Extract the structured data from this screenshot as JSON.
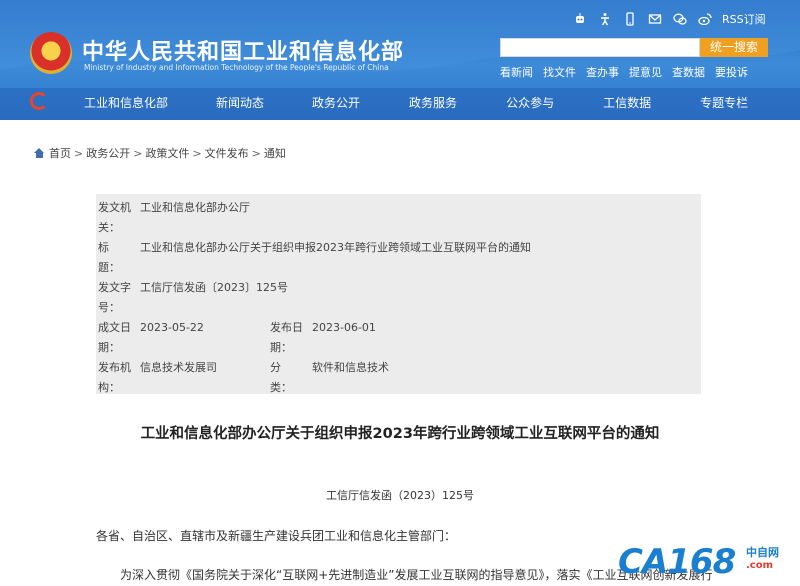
{
  "header": {
    "title": "中华人民共和国工业和信息化部",
    "subtitle_en": "Ministry of Industry and Information Technology of the People's Republic of China",
    "icons": [
      "robot-icon",
      "accessibility-icon",
      "mobile-icon",
      "mail-icon",
      "wechat-icon",
      "weibo-icon"
    ],
    "rss_label": "RSS订阅",
    "search_placeholder": "",
    "search_button": "统一搜索",
    "quick_links": [
      "看新闻",
      "找文件",
      "查办事",
      "提意见",
      "查数据",
      "要投诉"
    ]
  },
  "nav": {
    "items": [
      "工业和信息化部",
      "新闻动态",
      "政务公开",
      "政务服务",
      "公众参与",
      "工信数据",
      "专题专栏"
    ]
  },
  "breadcrumb": [
    "首页",
    "政务公开",
    "政策文件",
    "文件发布",
    "通知"
  ],
  "info": {
    "issuer_label": "发文机关：",
    "issuer": "工业和信息化部办公厅",
    "title_label": "标　　题：",
    "title": "工业和信息化部办公厅关于组织申报2023年跨行业跨领域工业互联网平台的通知",
    "number_label": "发文字号：",
    "number": "工信厅信发函〔2023〕125号",
    "date_label": "成文日期：",
    "date": "2023-05-22",
    "publish_label": "发布日期：",
    "publish": "2023-06-01",
    "org_label": "发布机构：",
    "org": "信息技术发展司",
    "category_label": "分　　类：",
    "category": "软件和信息技术"
  },
  "document": {
    "title": "工业和信息化部办公厅关于组织申报2023年跨行业跨领域工业互联网平台的通知",
    "number": "工信厅信发函（2023）125号",
    "addressee": "各省、自治区、直辖市及新疆生产建设兵团工业和信息化主管部门：",
    "body_start": "为深入贯彻《国务院关于深化“互联网+先进制造业”发展工业互联网的指导意见》，落实《工业互联网创新发展行"
  },
  "watermark": {
    "brand": "CA168",
    "cn": "中自网",
    "domain": ".com"
  },
  "colors": {
    "header_blue": "#2f76c9",
    "search_orange": "#f0a020",
    "table_grey": "#ececec",
    "watermark_blue": "#1a7fd0",
    "watermark_red": "#e63a2e"
  }
}
